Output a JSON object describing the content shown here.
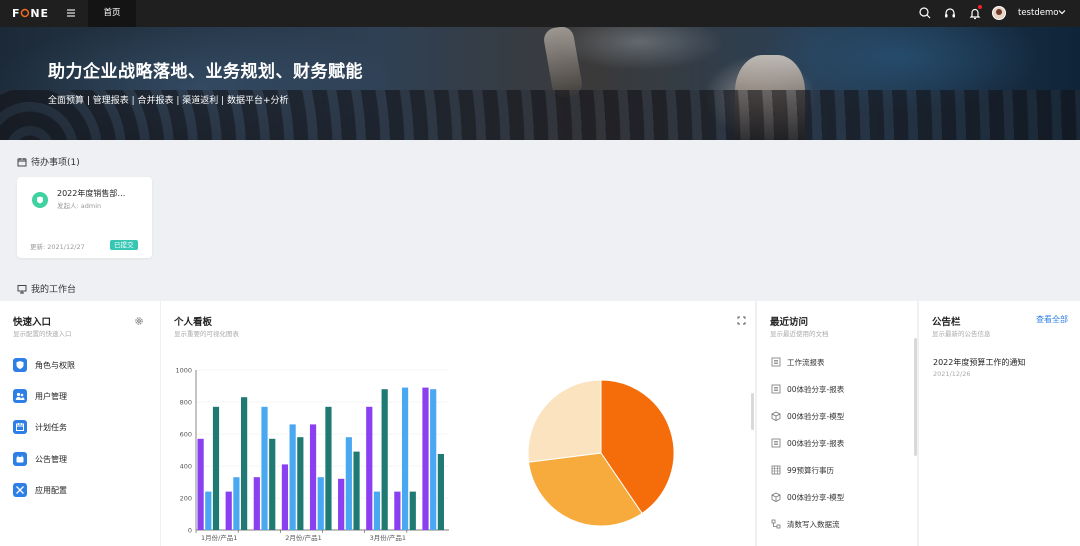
{
  "topbar": {
    "logo": "F◉NE",
    "logo_parts": [
      "F",
      "⭘",
      "NE"
    ],
    "menu_icon": "hamburger-icon",
    "home_tab": "首页",
    "icons": [
      "search-icon",
      "headset-icon",
      "bell-icon"
    ],
    "username": "testdemo"
  },
  "banner": {
    "title": "助力企业战略落地、业务规划、财务赋能",
    "subtitle": "全面预算 | 管理报表 | 合并报表 | 渠道返利 | 数据平台+分析"
  },
  "todo": {
    "section_title": "待办事项(1)",
    "items": [
      {
        "name": "2022年度销售部…",
        "initiator": "发起人: admin",
        "updated": "更新: 2021/12/27",
        "status": "已提交"
      }
    ]
  },
  "workbench": {
    "section_title": "我的工作台",
    "quick": {
      "title": "快速入口",
      "subtitle": "显示配置的快速入口",
      "items": [
        {
          "label": "角色与权限",
          "icon": "shield-icon"
        },
        {
          "label": "用户管理",
          "icon": "users-icon"
        },
        {
          "label": "计划任务",
          "icon": "calendar-icon"
        },
        {
          "label": "公告管理",
          "icon": "announcement-icon"
        },
        {
          "label": "应用配置",
          "icon": "tools-icon"
        }
      ]
    },
    "board": {
      "title": "个人看板",
      "subtitle": "显示重要的可视化图表"
    },
    "recent": {
      "title": "最近访问",
      "subtitle": "显示最近使用的文档",
      "items": [
        {
          "label": "工作流报表",
          "icon": "report-icon"
        },
        {
          "label": "00体验分享-报表",
          "icon": "report-icon"
        },
        {
          "label": "00体验分享-模型",
          "icon": "cube-icon"
        },
        {
          "label": "00体验分享-报表",
          "icon": "report-icon"
        },
        {
          "label": "99预算行事历",
          "icon": "calendar-grid-icon"
        },
        {
          "label": "00体验分享-模型",
          "icon": "cube-icon"
        },
        {
          "label": "清数写入数据流",
          "icon": "dataflow-icon"
        }
      ]
    },
    "notice": {
      "title": "公告栏",
      "subtitle": "显示最新的公告信息",
      "view_all": "查看全部",
      "items": [
        {
          "title": "2022年度预算工作的通知",
          "date": "2021/12/26"
        }
      ]
    }
  },
  "chart_data": [
    {
      "type": "bar",
      "categories": [
        "1月份/产品1",
        "",
        "2月份/产品1",
        "",
        "3月份/产品1",
        ""
      ],
      "ylim": [
        0,
        1000
      ],
      "yticks": [
        0,
        200,
        400,
        600,
        800,
        1000
      ],
      "series": [
        {
          "color": "#8a3ff0",
          "values": [
            570,
            240,
            330,
            410,
            660,
            320,
            770,
            240,
            890
          ]
        },
        {
          "color": "#4aa8f2",
          "values": [
            240,
            330,
            770,
            660,
            330,
            580,
            240,
            890,
            880
          ]
        },
        {
          "color": "#1f7a74",
          "values": [
            770,
            830,
            570,
            580,
            770,
            490,
            880,
            240,
            475
          ]
        }
      ]
    },
    {
      "type": "pie",
      "values": [
        40.5,
        32.5,
        27
      ],
      "colors": [
        "#f56c0a",
        "#f7ab3c",
        "#fce3c0"
      ]
    }
  ]
}
